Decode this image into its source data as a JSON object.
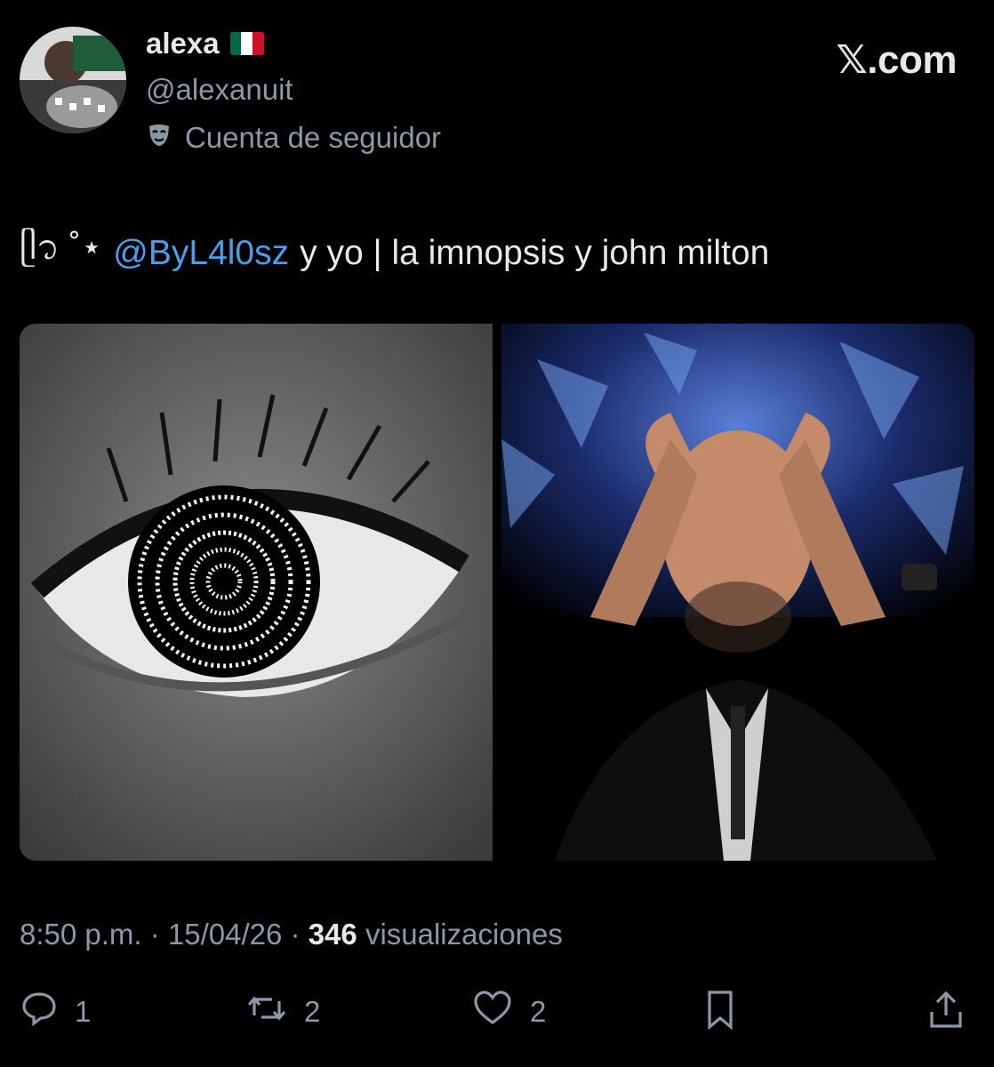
{
  "author": {
    "display_name": "alexa",
    "handle": "@alexanuit",
    "account_label": "Cuenta de seguidor",
    "flag_colors": [
      "#006847",
      "#ffffff",
      "#ce1126"
    ]
  },
  "brand": "𝕏.com",
  "tweet": {
    "prefix": "ᥫ᭡ ˚⋆",
    "mention": "@ByL4l0sz",
    "text": "y yo | la imnopsis y john milton"
  },
  "meta": {
    "time": "8:50 p.m.",
    "date": "15/04/26",
    "views_count": "346",
    "views_label": "visualizaciones",
    "separator": " · "
  },
  "actions": {
    "replies": "1",
    "retweets": "2",
    "likes": "2"
  },
  "colors": {
    "background": "#000000",
    "text_primary": "#e7e9ea",
    "text_secondary": "#8b98a5",
    "link": "#4a9eea"
  },
  "icons": [
    "mask-icon",
    "reply-icon",
    "retweet-icon",
    "like-icon",
    "bookmark-icon",
    "share-icon"
  ]
}
